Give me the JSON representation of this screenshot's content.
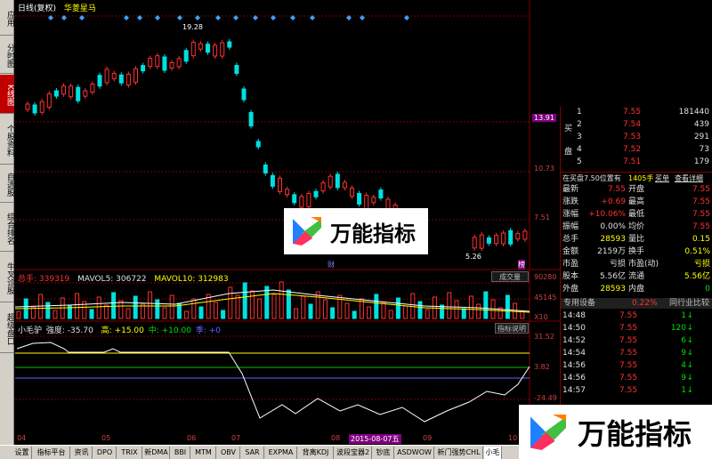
{
  "left_tabs": [
    {
      "label": "应用",
      "active": false
    },
    {
      "label": "分时图",
      "active": false
    },
    {
      "label": "K线图",
      "active": true
    },
    {
      "label": "个股资料",
      "active": false
    },
    {
      "label": "自选股",
      "active": false
    },
    {
      "label": "综合排名",
      "active": false
    },
    {
      "label": "牛叉诊股",
      "active": false
    },
    {
      "label": "超级盘口",
      "active": false
    }
  ],
  "chart_title": {
    "period": "日线(复权)",
    "stock_name": "华菱星马"
  },
  "price_labels": {
    "high": "19.28",
    "low": "5.26"
  },
  "price_axis": [
    "13.91",
    "10.73",
    "7.51"
  ],
  "markers": {
    "cai": "财",
    "hold": "榜"
  },
  "volume_header": {
    "label": "总手: 339319",
    "ma5": "MAVOL5: 306722",
    "ma10": "MAVOL10: 312983",
    "button": "成交量"
  },
  "volume_axis": [
    "90280",
    "45145",
    "X10"
  ],
  "indicator_header": {
    "name": "小毛驴",
    "f1": "強度: -35.70",
    "f2": "高: +15.00",
    "f3": "中: +10.00",
    "f4": "季: +0",
    "button": "指标说明"
  },
  "indicator_axis": [
    "31.52",
    "3.82",
    "-24.49"
  ],
  "date_axis": [
    "04",
    "05",
    "06",
    "07",
    "08",
    "2015-08-07五",
    "09",
    "10"
  ],
  "order_book": {
    "sell": [
      {
        "level": "1",
        "price": "7.55",
        "vol": "181440"
      },
      {
        "level": "2",
        "price": "7.54",
        "vol": "439"
      },
      {
        "level": "3",
        "price": "7.53",
        "vol": "291"
      },
      {
        "level": "4",
        "price": "7.52",
        "vol": "73"
      },
      {
        "level": "5",
        "price": "7.51",
        "vol": "179"
      }
    ],
    "side_label_buy": "买",
    "side_label_pan": "盘"
  },
  "queue_bar": {
    "text": "在买盘7.50位置有",
    "count": "1405手",
    "link1": "买单",
    "link2": "查看详细"
  },
  "stats": [
    {
      "k1": "最新",
      "v1": "7.55",
      "k2": "开盘",
      "v2": "7.55"
    },
    {
      "k1": "涨跌",
      "v1": "+0.69",
      "k2": "最高",
      "v2": "7.55"
    },
    {
      "k1": "涨幅",
      "v1": "+10.06%",
      "k2": "最低",
      "v2": "7.55"
    },
    {
      "k1": "振幅",
      "v1": "0.00%",
      "k2": "均价",
      "v2": "7.55"
    },
    {
      "k1": "总手",
      "v1": "28593",
      "k2": "量比",
      "v2": "0.15"
    },
    {
      "k1": "金额",
      "v1": "2159万",
      "k2": "换手",
      "v2": "0.51%"
    },
    {
      "k1": "市盈",
      "v1": "亏损",
      "k2": "市盈(动)",
      "v2": "亏损"
    },
    {
      "k1": "股本",
      "v1": "5.56亿",
      "k2": "流通",
      "v2": "5.56亿"
    },
    {
      "k1": "外盘",
      "v1": "28593",
      "k2": "内盘",
      "v2": "0"
    }
  ],
  "section_tabs": {
    "left": "专用设备",
    "mid": "0.22%",
    "right": "同行业比较"
  },
  "trades": [
    {
      "time": "14:48",
      "price": "7.55",
      "vol": "1"
    },
    {
      "time": "14:50",
      "price": "7.55",
      "vol": "120"
    },
    {
      "time": "14:52",
      "price": "7.55",
      "vol": "6"
    },
    {
      "time": "14:54",
      "price": "7.55",
      "vol": "9"
    },
    {
      "time": "14:56",
      "price": "7.55",
      "vol": "4"
    },
    {
      "time": "14:56",
      "price": "7.55",
      "vol": "9"
    },
    {
      "time": "14:57",
      "price": "7.55",
      "vol": "1"
    }
  ],
  "bottom_tabs": [
    "设置",
    "指标平台",
    "资讯",
    "DPO",
    "TRIX",
    "新DMA",
    "BBI",
    "MTM",
    "OBV",
    "SAR",
    "EXPMA",
    "背离KDJ",
    "波段宝器2",
    "钞底",
    "ASDWOW",
    "新门强势CHL",
    "小毛"
  ],
  "watermark_text": "万能指标",
  "colors": {
    "up": "#ff3030",
    "down": "#00e0e0",
    "bg": "#000000",
    "grid": "#800000"
  }
}
